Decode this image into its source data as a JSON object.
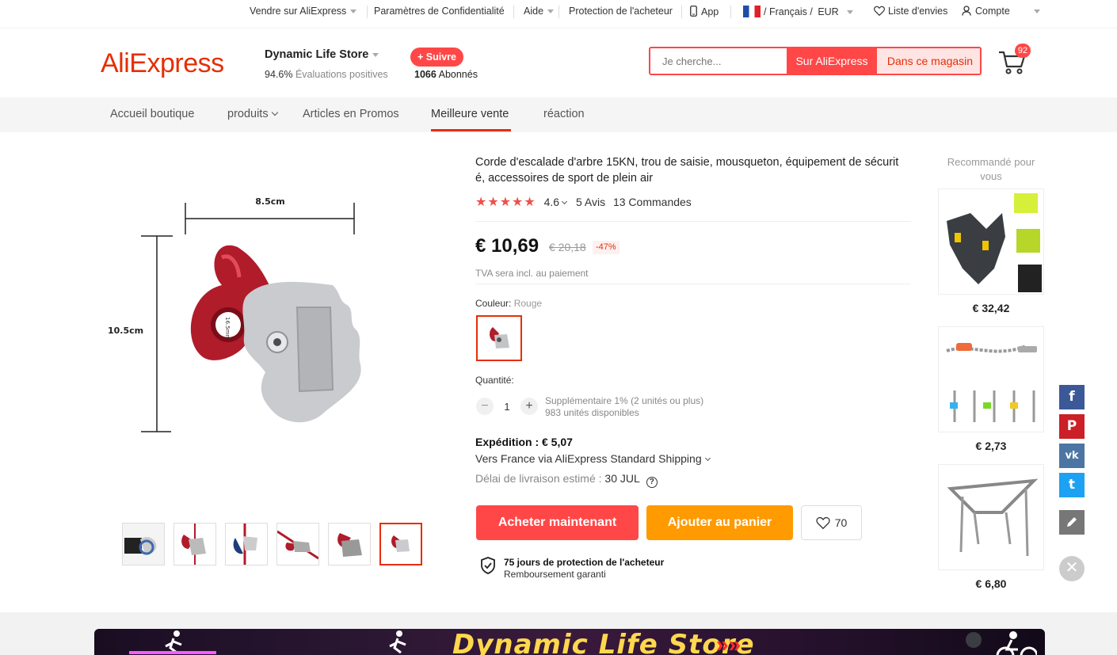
{
  "topbar": {
    "sell": "Vendre sur AliExpress",
    "privacy": "Paramètres de Confidentialité",
    "help": "Aide",
    "protection": "Protection de l'acheteur",
    "app": "App",
    "locale": "/ Français /",
    "currency": "EUR",
    "wishlist": "Liste d'envies",
    "account": "Compte"
  },
  "header": {
    "logo": "AliExpress",
    "store_name": "Dynamic Life Store",
    "rating_value": "94.6%",
    "rating_label": "Évaluations positives",
    "follow_label": "+ Suivre",
    "followers_count": "1066",
    "followers_label": "Abonnés",
    "search_placeholder": "Je cherche...",
    "search_site_label": "Sur AliExpress",
    "search_store_label": "Dans ce magasin",
    "cart_count": "92"
  },
  "nav": {
    "tabs": [
      "Accueil boutique",
      "produits",
      "Articles en Promos",
      "Meilleure vente",
      "réaction"
    ],
    "active": "Meilleure vente"
  },
  "gallery": {
    "dim_width": "8.5cm",
    "dim_height": "10.5cm",
    "dim_hole": "16.5mm"
  },
  "product": {
    "title": "Corde d'escalade d'arbre 15KN, trou de saisie, mousqueton, équipement de sécurit é, accessoires de sport de plein air",
    "stars": "★★★★★",
    "rating": "4.6",
    "reviews": "5 Avis",
    "orders": "13 Commandes",
    "price": "€ 10,69",
    "old_price": "€ 20,18",
    "discount": "-47%",
    "vat_note": "TVA sera incl. au paiement",
    "color_label": "Couleur:",
    "color_value": "Rouge",
    "qty_label": "Quantité:",
    "qty_minus": "−",
    "qty_value": "1",
    "qty_plus": "+",
    "qty_bulk": "Supplémentaire 1% (2 unités ou plus)",
    "qty_available": "983 unités disponibles",
    "shipping_title": "Expédition : € 5,07",
    "shipping_line": "Vers France via AliExpress Standard Shipping",
    "delivery_label": "Délai de livraison estimé :",
    "delivery_date": "30 JUL",
    "buy_label": "Acheter maintenant",
    "cart_label": "Ajouter au panier",
    "wish_count": "70",
    "protection_title": "75 jours de protection de l'acheteur",
    "protection_sub": "Remboursement garanti"
  },
  "recommended": {
    "title": "Recommandé pour vous",
    "items": [
      {
        "price": "€ 32,42"
      },
      {
        "price": "€ 2,73"
      },
      {
        "price": "€ 6,80"
      }
    ]
  },
  "share": {
    "facebook": "f",
    "pinterest": "P",
    "vk": "vk",
    "twitter": "t"
  },
  "banner": {
    "text": "Dynamic Life Store",
    "arrows": "»»"
  },
  "colors": {
    "accent": "#ff4747",
    "brand": "#e62e04",
    "cart_button": "#ff9a00",
    "facebook": "#3b5998",
    "pinterest": "#cb2027",
    "vk": "#4c75a3",
    "twitter": "#1da1f2",
    "edit": "#777777"
  }
}
